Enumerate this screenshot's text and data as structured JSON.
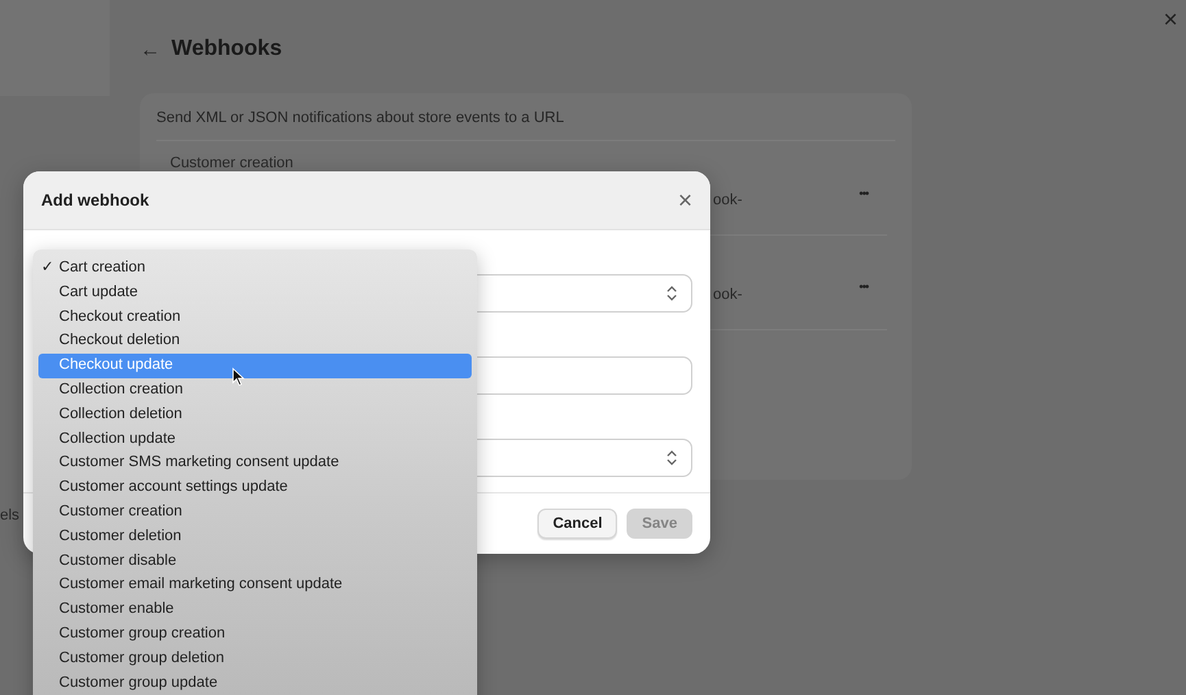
{
  "close_label": "×",
  "sidebar": {
    "label": "els"
  },
  "page": {
    "back": "←",
    "title": "Webhooks",
    "description": "Send XML or JSON notifications about store events to a URL",
    "webhooks": [
      {
        "event": "Customer creation",
        "url": "ook-",
        "menu": "•••"
      },
      {
        "url": "ook-",
        "menu": "•••"
      }
    ]
  },
  "dialog": {
    "title": "Add webhook",
    "close": "×",
    "buttons": [
      {
        "label": "Cancel",
        "disabled": false
      },
      {
        "label": "Save",
        "disabled": true
      }
    ]
  },
  "dropdown": {
    "check": "✓",
    "items": [
      {
        "label": "Cart creation",
        "checked": true,
        "highlighted": false
      },
      {
        "label": "Cart update",
        "checked": false,
        "highlighted": false
      },
      {
        "label": "Checkout creation",
        "checked": false,
        "highlighted": false
      },
      {
        "label": "Checkout deletion",
        "checked": false,
        "highlighted": false
      },
      {
        "label": "Checkout update",
        "checked": false,
        "highlighted": true
      },
      {
        "label": "Collection creation",
        "checked": false,
        "highlighted": false
      },
      {
        "label": "Collection deletion",
        "checked": false,
        "highlighted": false
      },
      {
        "label": "Collection update",
        "checked": false,
        "highlighted": false
      },
      {
        "label": "Customer SMS marketing consent update",
        "checked": false,
        "highlighted": false
      },
      {
        "label": "Customer account settings update",
        "checked": false,
        "highlighted": false
      },
      {
        "label": "Customer creation",
        "checked": false,
        "highlighted": false
      },
      {
        "label": "Customer deletion",
        "checked": false,
        "highlighted": false
      },
      {
        "label": "Customer disable",
        "checked": false,
        "highlighted": false
      },
      {
        "label": "Customer email marketing consent update",
        "checked": false,
        "highlighted": false
      },
      {
        "label": "Customer enable",
        "checked": false,
        "highlighted": false
      },
      {
        "label": "Customer group creation",
        "checked": false,
        "highlighted": false
      },
      {
        "label": "Customer group deletion",
        "checked": false,
        "highlighted": false
      },
      {
        "label": "Customer group update",
        "checked": false,
        "highlighted": false
      }
    ]
  }
}
